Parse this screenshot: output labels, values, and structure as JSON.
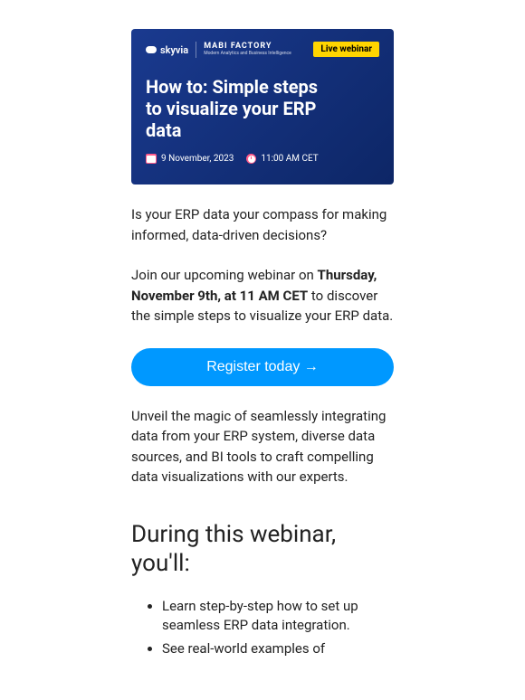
{
  "hero": {
    "brand1": "skyvia",
    "brand2_title": "MABI FACTORY",
    "brand2_sub": "Modern Analytics and Business Intelligence",
    "badge": "Live webinar",
    "title": "How to: Simple steps to visualize your ERP data",
    "date": "9 November, 2023",
    "time": "11:00 AM CET"
  },
  "intro": {
    "p1": "Is your ERP data your compass for making informed, data-driven decisions?",
    "p2_pre": "Join our upcoming webinar on ",
    "p2_bold": "Thursday, November 9th, at 11 AM CET",
    "p2_post": " to discover the simple steps to visualize your ERP data."
  },
  "cta": {
    "label": "Register today →"
  },
  "para2": "Unveil the magic of seamlessly integrating data from your ERP system, diverse data sources, and BI tools to craft compelling data visualizations with our experts.",
  "h2": "During this webinar, you'll:",
  "bullets": [
    "Learn step-by-step how to set up seamless ERP data integration.",
    "See real-world examples of"
  ]
}
